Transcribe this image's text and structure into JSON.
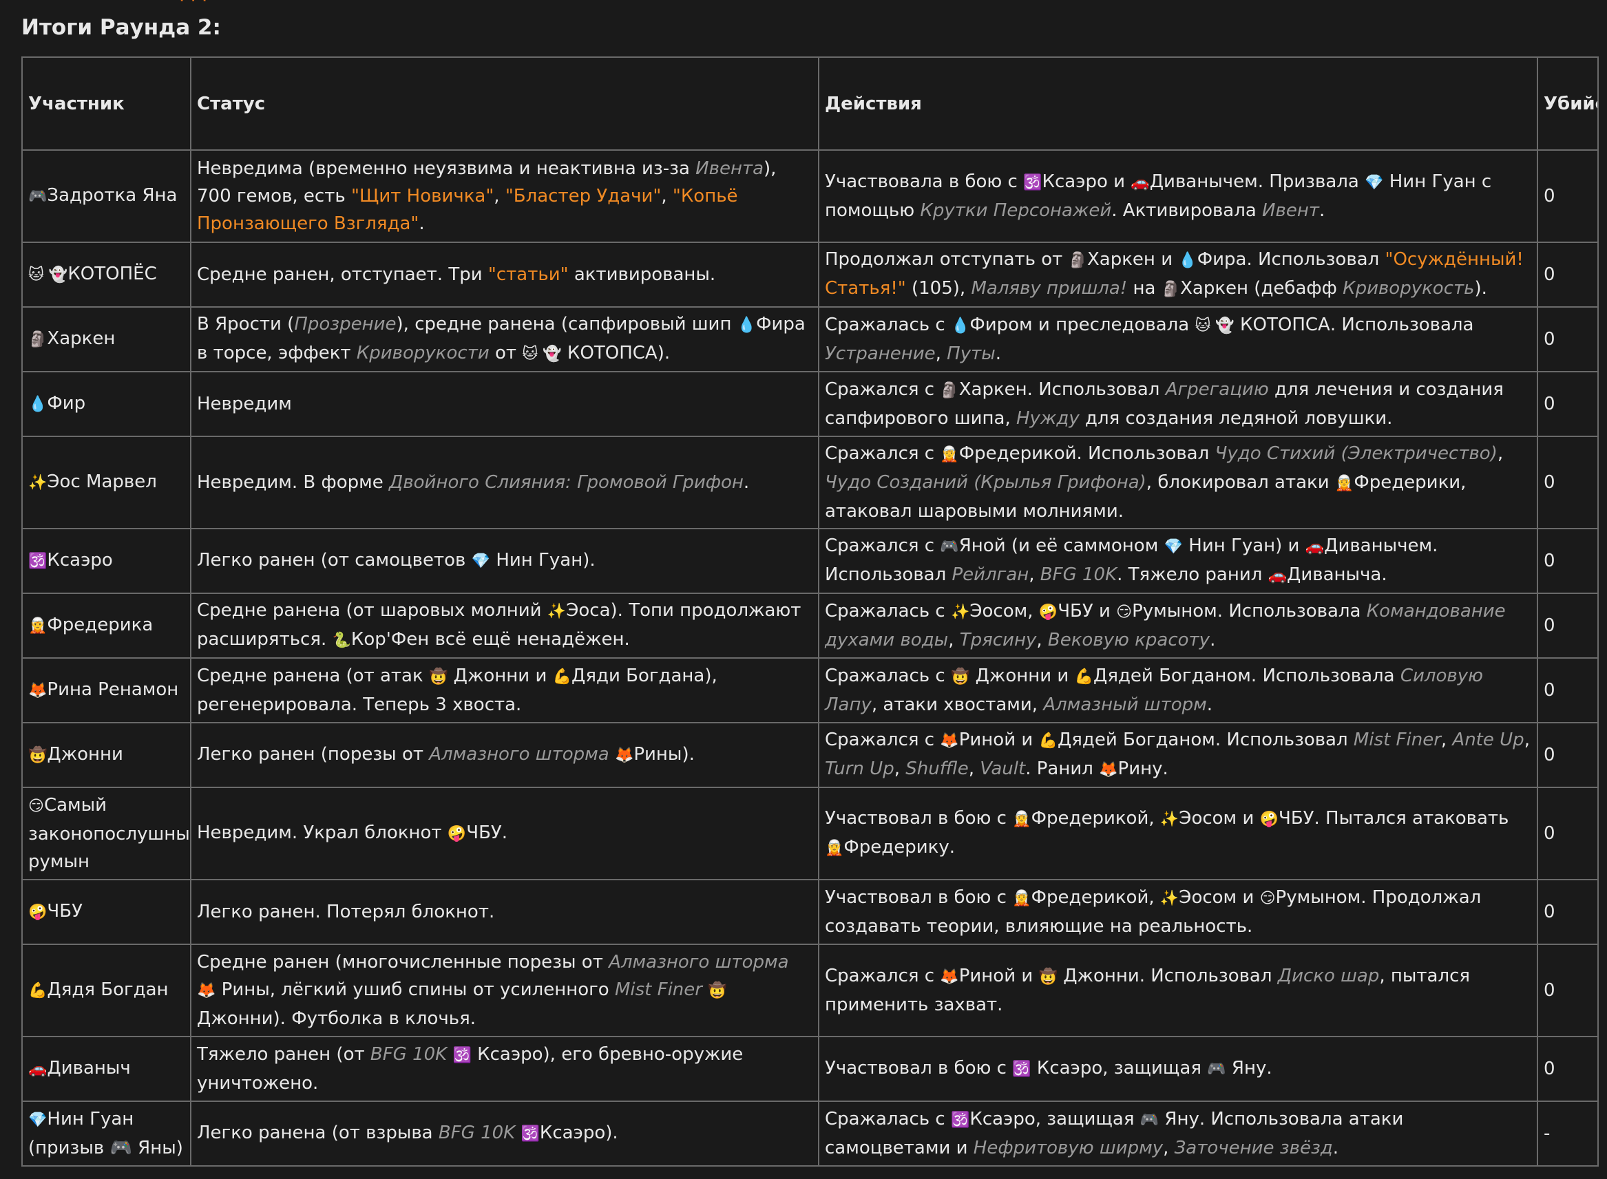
{
  "page": {
    "title": "Итоги Раунда 2:"
  },
  "table": {
    "headers": {
      "participant": "Участник",
      "status": "Статус",
      "actions": "Действия",
      "kills": "Убийства"
    },
    "rows": [
      {
        "emoji": "🎮",
        "name": "Задротка Яна",
        "status": [
          {
            "t": "Невредима (временно неуязвима и неактивна из-за "
          },
          {
            "t": "Ивента",
            "s": "it"
          },
          {
            "t": "), 700 гемов, есть "
          },
          {
            "t": "\"Щит Новичка\"",
            "s": "or"
          },
          {
            "t": ", "
          },
          {
            "t": "\"Бластер Удачи\"",
            "s": "or"
          },
          {
            "t": ", "
          },
          {
            "t": "\"Копьё Пронзающего Взгляда\"",
            "s": "or"
          },
          {
            "t": "."
          }
        ],
        "actions": [
          {
            "t": "Участвовала в бою с "
          },
          {
            "t": "🕉️",
            "s": "e"
          },
          {
            "t": "Ксаэро и "
          },
          {
            "t": "🚗",
            "s": "e"
          },
          {
            "t": "Диванычем. Призвала "
          },
          {
            "t": "💎",
            "s": "e"
          },
          {
            "t": " Нин Гуан с помощью "
          },
          {
            "t": "Крутки Персонажей",
            "s": "it"
          },
          {
            "t": ". Активировала "
          },
          {
            "t": "Ивент",
            "s": "it"
          },
          {
            "t": "."
          }
        ],
        "kills": "0",
        "height": 134
      },
      {
        "emoji": "🐱 👻",
        "name": "КОТОПЁС",
        "status": [
          {
            "t": "Средне ранен, отступает. Три "
          },
          {
            "t": "\"статьи\"",
            "s": "or"
          },
          {
            "t": " активированы."
          }
        ],
        "actions": [
          {
            "t": "Продолжал отступать от "
          },
          {
            "t": "🗿",
            "s": "e"
          },
          {
            "t": "Харкен и "
          },
          {
            "t": "💧",
            "s": "e"
          },
          {
            "t": "Фира. Использовал "
          },
          {
            "t": "\"Осуждённый! Статья!\"",
            "s": "or"
          },
          {
            "t": " (105), "
          },
          {
            "t": "Маляву пришла!",
            "s": "it"
          },
          {
            "t": " на "
          },
          {
            "t": "🗿",
            "s": "e"
          },
          {
            "t": "Харкен (дебафф "
          },
          {
            "t": "Криворукость",
            "s": "it"
          },
          {
            "t": ")."
          }
        ],
        "kills": "0",
        "height": 94
      },
      {
        "emoji": "🗿",
        "name": "Харкен",
        "status": [
          {
            "t": "В Ярости ("
          },
          {
            "t": "Прозрение",
            "s": "it"
          },
          {
            "t": "), средне ранена (сапфировый шип "
          },
          {
            "t": "💧",
            "s": "e"
          },
          {
            "t": "Фира в торсе, эффект "
          },
          {
            "t": "Криворукости",
            "s": "it"
          },
          {
            "t": " от "
          },
          {
            "t": "🐱 👻",
            "s": "e"
          },
          {
            "t": " КОТОПСА)."
          }
        ],
        "actions": [
          {
            "t": "Сражалась с "
          },
          {
            "t": "💧",
            "s": "e"
          },
          {
            "t": "Фиром и преследовала "
          },
          {
            "t": "🐱 👻",
            "s": "e"
          },
          {
            "t": " КОТОПСА. Использовала "
          },
          {
            "t": "Устранение",
            "s": "it"
          },
          {
            "t": ", "
          },
          {
            "t": "Путы",
            "s": "it"
          },
          {
            "t": "."
          }
        ],
        "kills": "0",
        "height": 94
      },
      {
        "emoji": "💧",
        "name": "Фир",
        "status": [
          {
            "t": "Невредим"
          }
        ],
        "actions": [
          {
            "t": "Сражался с "
          },
          {
            "t": "🗿",
            "s": "e"
          },
          {
            "t": "Харкен. Использовал "
          },
          {
            "t": "Агрегацию",
            "s": "it"
          },
          {
            "t": " для лечения и создания сапфирового шипа, "
          },
          {
            "t": "Нужду",
            "s": "it"
          },
          {
            "t": " для создания ледяной ловушки."
          }
        ],
        "kills": "0",
        "height": 94
      },
      {
        "emoji": "✨",
        "name": "Эос Марвел",
        "status": [
          {
            "t": "Невредим. В форме "
          },
          {
            "t": "Двойного Слияния: Громовой Грифон",
            "s": "it"
          },
          {
            "t": "."
          }
        ],
        "actions": [
          {
            "t": "Сражался с "
          },
          {
            "t": "🧝",
            "s": "e"
          },
          {
            "t": "Фредерикой. Использовал "
          },
          {
            "t": "Чудо Стихий (Электричество)",
            "s": "it"
          },
          {
            "t": ", "
          },
          {
            "t": "Чудо Созданий (Крылья Грифона)",
            "s": "it"
          },
          {
            "t": ", блокировал атаки "
          },
          {
            "t": "🧝",
            "s": "e"
          },
          {
            "t": "Фредерики, атаковал шаровыми молниями."
          }
        ],
        "kills": "0",
        "height": 134
      },
      {
        "emoji": "🕉️",
        "name": "Ксаэро",
        "status": [
          {
            "t": "Легко ранен (от самоцветов "
          },
          {
            "t": "💎",
            "s": "e"
          },
          {
            "t": " Нин Гуан)."
          }
        ],
        "actions": [
          {
            "t": "Сражался с "
          },
          {
            "t": "🎮",
            "s": "e"
          },
          {
            "t": "Яной (и её саммоном "
          },
          {
            "t": "💎",
            "s": "e"
          },
          {
            "t": " Нин Гуан) и "
          },
          {
            "t": "🚗",
            "s": "e"
          },
          {
            "t": "Диванычем. Использовал "
          },
          {
            "t": "Рейлган",
            "s": "it"
          },
          {
            "t": ", "
          },
          {
            "t": "BFG 10K",
            "s": "it"
          },
          {
            "t": ". Тяжело ранил "
          },
          {
            "t": "🚗",
            "s": "e"
          },
          {
            "t": "Диваныча."
          }
        ],
        "kills": "0",
        "height": 94
      },
      {
        "emoji": "🧝",
        "name": "Фредерика",
        "status": [
          {
            "t": "Средне ранена (от шаровых молний "
          },
          {
            "t": "✨",
            "s": "e"
          },
          {
            "t": "Эоса). Топи продолжают расширяться. "
          },
          {
            "t": "🐍",
            "s": "e"
          },
          {
            "t": "Кор'Фен всё ещё ненадёжен."
          }
        ],
        "actions": [
          {
            "t": "Сражалась с "
          },
          {
            "t": "✨",
            "s": "e"
          },
          {
            "t": "Эосом, "
          },
          {
            "t": "🤪",
            "s": "e"
          },
          {
            "t": "ЧБУ и "
          },
          {
            "t": "😏",
            "s": "e"
          },
          {
            "t": "Румыном. Использовала "
          },
          {
            "t": "Командование духами воды",
            "s": "it"
          },
          {
            "t": ", "
          },
          {
            "t": "Трясину",
            "s": "it"
          },
          {
            "t": ", "
          },
          {
            "t": "Вековую красоту",
            "s": "it"
          },
          {
            "t": "."
          }
        ],
        "kills": "0",
        "height": 94
      },
      {
        "emoji": "🦊",
        "name": "Рина Ренамон",
        "status": [
          {
            "t": "Средне ранена (от атак "
          },
          {
            "t": "🤠",
            "s": "e"
          },
          {
            "t": " Джонни и "
          },
          {
            "t": "💪",
            "s": "e"
          },
          {
            "t": "Дяди Богдана), регенерировала. Теперь 3 хвоста."
          }
        ],
        "actions": [
          {
            "t": "Сражалась с "
          },
          {
            "t": "🤠",
            "s": "e"
          },
          {
            "t": " Джонни и "
          },
          {
            "t": "💪",
            "s": "e"
          },
          {
            "t": "Дядей Богданом. Использовала "
          },
          {
            "t": "Силовую Лапу",
            "s": "it"
          },
          {
            "t": ", атаки хвостами, "
          },
          {
            "t": "Алмазный шторм",
            "s": "it"
          },
          {
            "t": "."
          }
        ],
        "kills": "0",
        "height": 94
      },
      {
        "emoji": "🤠",
        "name": "Джонни",
        "status": [
          {
            "t": "Легко ранен (порезы от "
          },
          {
            "t": "Алмазного шторма",
            "s": "it"
          },
          {
            "t": " "
          },
          {
            "t": "🦊",
            "s": "e"
          },
          {
            "t": "Рины)."
          }
        ],
        "actions": [
          {
            "t": "Сражался с "
          },
          {
            "t": "🦊",
            "s": "e"
          },
          {
            "t": "Риной и "
          },
          {
            "t": "💪",
            "s": "e"
          },
          {
            "t": "Дядей Богданом. Использовал "
          },
          {
            "t": "Mist Finer",
            "s": "it"
          },
          {
            "t": ", "
          },
          {
            "t": "Ante Up",
            "s": "it"
          },
          {
            "t": ", "
          },
          {
            "t": "Turn Up",
            "s": "it"
          },
          {
            "t": ", "
          },
          {
            "t": "Shuffle",
            "s": "it"
          },
          {
            "t": ", "
          },
          {
            "t": "Vault",
            "s": "it"
          },
          {
            "t": ". Ранил "
          },
          {
            "t": "🦊",
            "s": "e"
          },
          {
            "t": "Рину."
          }
        ],
        "kills": "0",
        "height": 94
      },
      {
        "emoji": "😏",
        "name": "Самый законопослушный румын",
        "status": [
          {
            "t": "Невредим. Украл блокнот "
          },
          {
            "t": "🤪",
            "s": "e"
          },
          {
            "t": "ЧБУ."
          }
        ],
        "actions": [
          {
            "t": "Участвовал в бою с "
          },
          {
            "t": "🧝",
            "s": "e"
          },
          {
            "t": "Фредерикой, "
          },
          {
            "t": "✨",
            "s": "e"
          },
          {
            "t": "Эосом и "
          },
          {
            "t": "🤪",
            "s": "e"
          },
          {
            "t": "ЧБУ. Пытался атаковать "
          },
          {
            "t": "🧝",
            "s": "e"
          },
          {
            "t": "Фредерику."
          }
        ],
        "kills": "0",
        "height": 134
      },
      {
        "emoji": "🤪",
        "name": "ЧБУ",
        "status": [
          {
            "t": "Легко ранен. Потерял блокнот."
          }
        ],
        "actions": [
          {
            "t": "Участвовал в бою с "
          },
          {
            "t": "🧝",
            "s": "e"
          },
          {
            "t": "Фредерикой, "
          },
          {
            "t": "✨",
            "s": "e"
          },
          {
            "t": "Эосом и "
          },
          {
            "t": "😏",
            "s": "e"
          },
          {
            "t": "Румыном. Продолжал создавать теории, влияющие на реальность."
          }
        ],
        "kills": "0",
        "height": 94
      },
      {
        "emoji": "💪",
        "name": "Дядя Богдан",
        "status": [
          {
            "t": "Средне ранен (многочисленные порезы от "
          },
          {
            "t": "Алмазного шторма",
            "s": "it"
          },
          {
            "t": " "
          },
          {
            "t": "🦊",
            "s": "e"
          },
          {
            "t": " Рины, лёгкий ушиб спины от усиленного "
          },
          {
            "t": "Mist Finer",
            "s": "it"
          },
          {
            "t": " "
          },
          {
            "t": "🤠",
            "s": "e"
          },
          {
            "t": " Джонни). Футболка в клочья."
          }
        ],
        "actions": [
          {
            "t": "Сражался с "
          },
          {
            "t": "🦊",
            "s": "e"
          },
          {
            "t": "Риной и "
          },
          {
            "t": "🤠",
            "s": "e"
          },
          {
            "t": " Джонни. Использовал "
          },
          {
            "t": "Диско шар",
            "s": "it"
          },
          {
            "t": ", пытался применить захват."
          }
        ],
        "kills": "0",
        "height": 134
      },
      {
        "emoji": "🚗",
        "name": "Диваныч",
        "status": [
          {
            "t": "Тяжело ранен (от "
          },
          {
            "t": "BFG 10K",
            "s": "it"
          },
          {
            "t": " "
          },
          {
            "t": "🕉️",
            "s": "e"
          },
          {
            "t": " Ксаэро), его бревно-оружие уничтожено."
          }
        ],
        "actions": [
          {
            "t": "Участвовал в бою с "
          },
          {
            "t": "🕉️",
            "s": "e"
          },
          {
            "t": " Ксаэро, защищая "
          },
          {
            "t": "🎮",
            "s": "e"
          },
          {
            "t": " Яну."
          }
        ],
        "kills": "0",
        "height": 94
      },
      {
        "emoji": "💎",
        "name": "Нин Гуан (призыв 🎮 Яны)",
        "status": [
          {
            "t": "Легко ранена (от взрыва "
          },
          {
            "t": "BFG 10K",
            "s": "it"
          },
          {
            "t": " "
          },
          {
            "t": "🕉️",
            "s": "e"
          },
          {
            "t": "Ксаэро)."
          }
        ],
        "actions": [
          {
            "t": "Сражалась с "
          },
          {
            "t": "🕉️",
            "s": "e"
          },
          {
            "t": "Ксаэро, защищая "
          },
          {
            "t": "🎮",
            "s": "e"
          },
          {
            "t": " Яну. Использовала атаки самоцветами и "
          },
          {
            "t": "Нефритовую ширму",
            "s": "it"
          },
          {
            "t": ", "
          },
          {
            "t": "Заточение звёзд",
            "s": "it"
          },
          {
            "t": "."
          }
        ],
        "kills": "-",
        "height": 94
      }
    ]
  },
  "colors": {
    "background": "#1a1a1a",
    "text": "#e8e8e8",
    "border": "#6a6a6a",
    "italic_text": "#9a9a9a",
    "orange_highlight": "#f08a24"
  }
}
